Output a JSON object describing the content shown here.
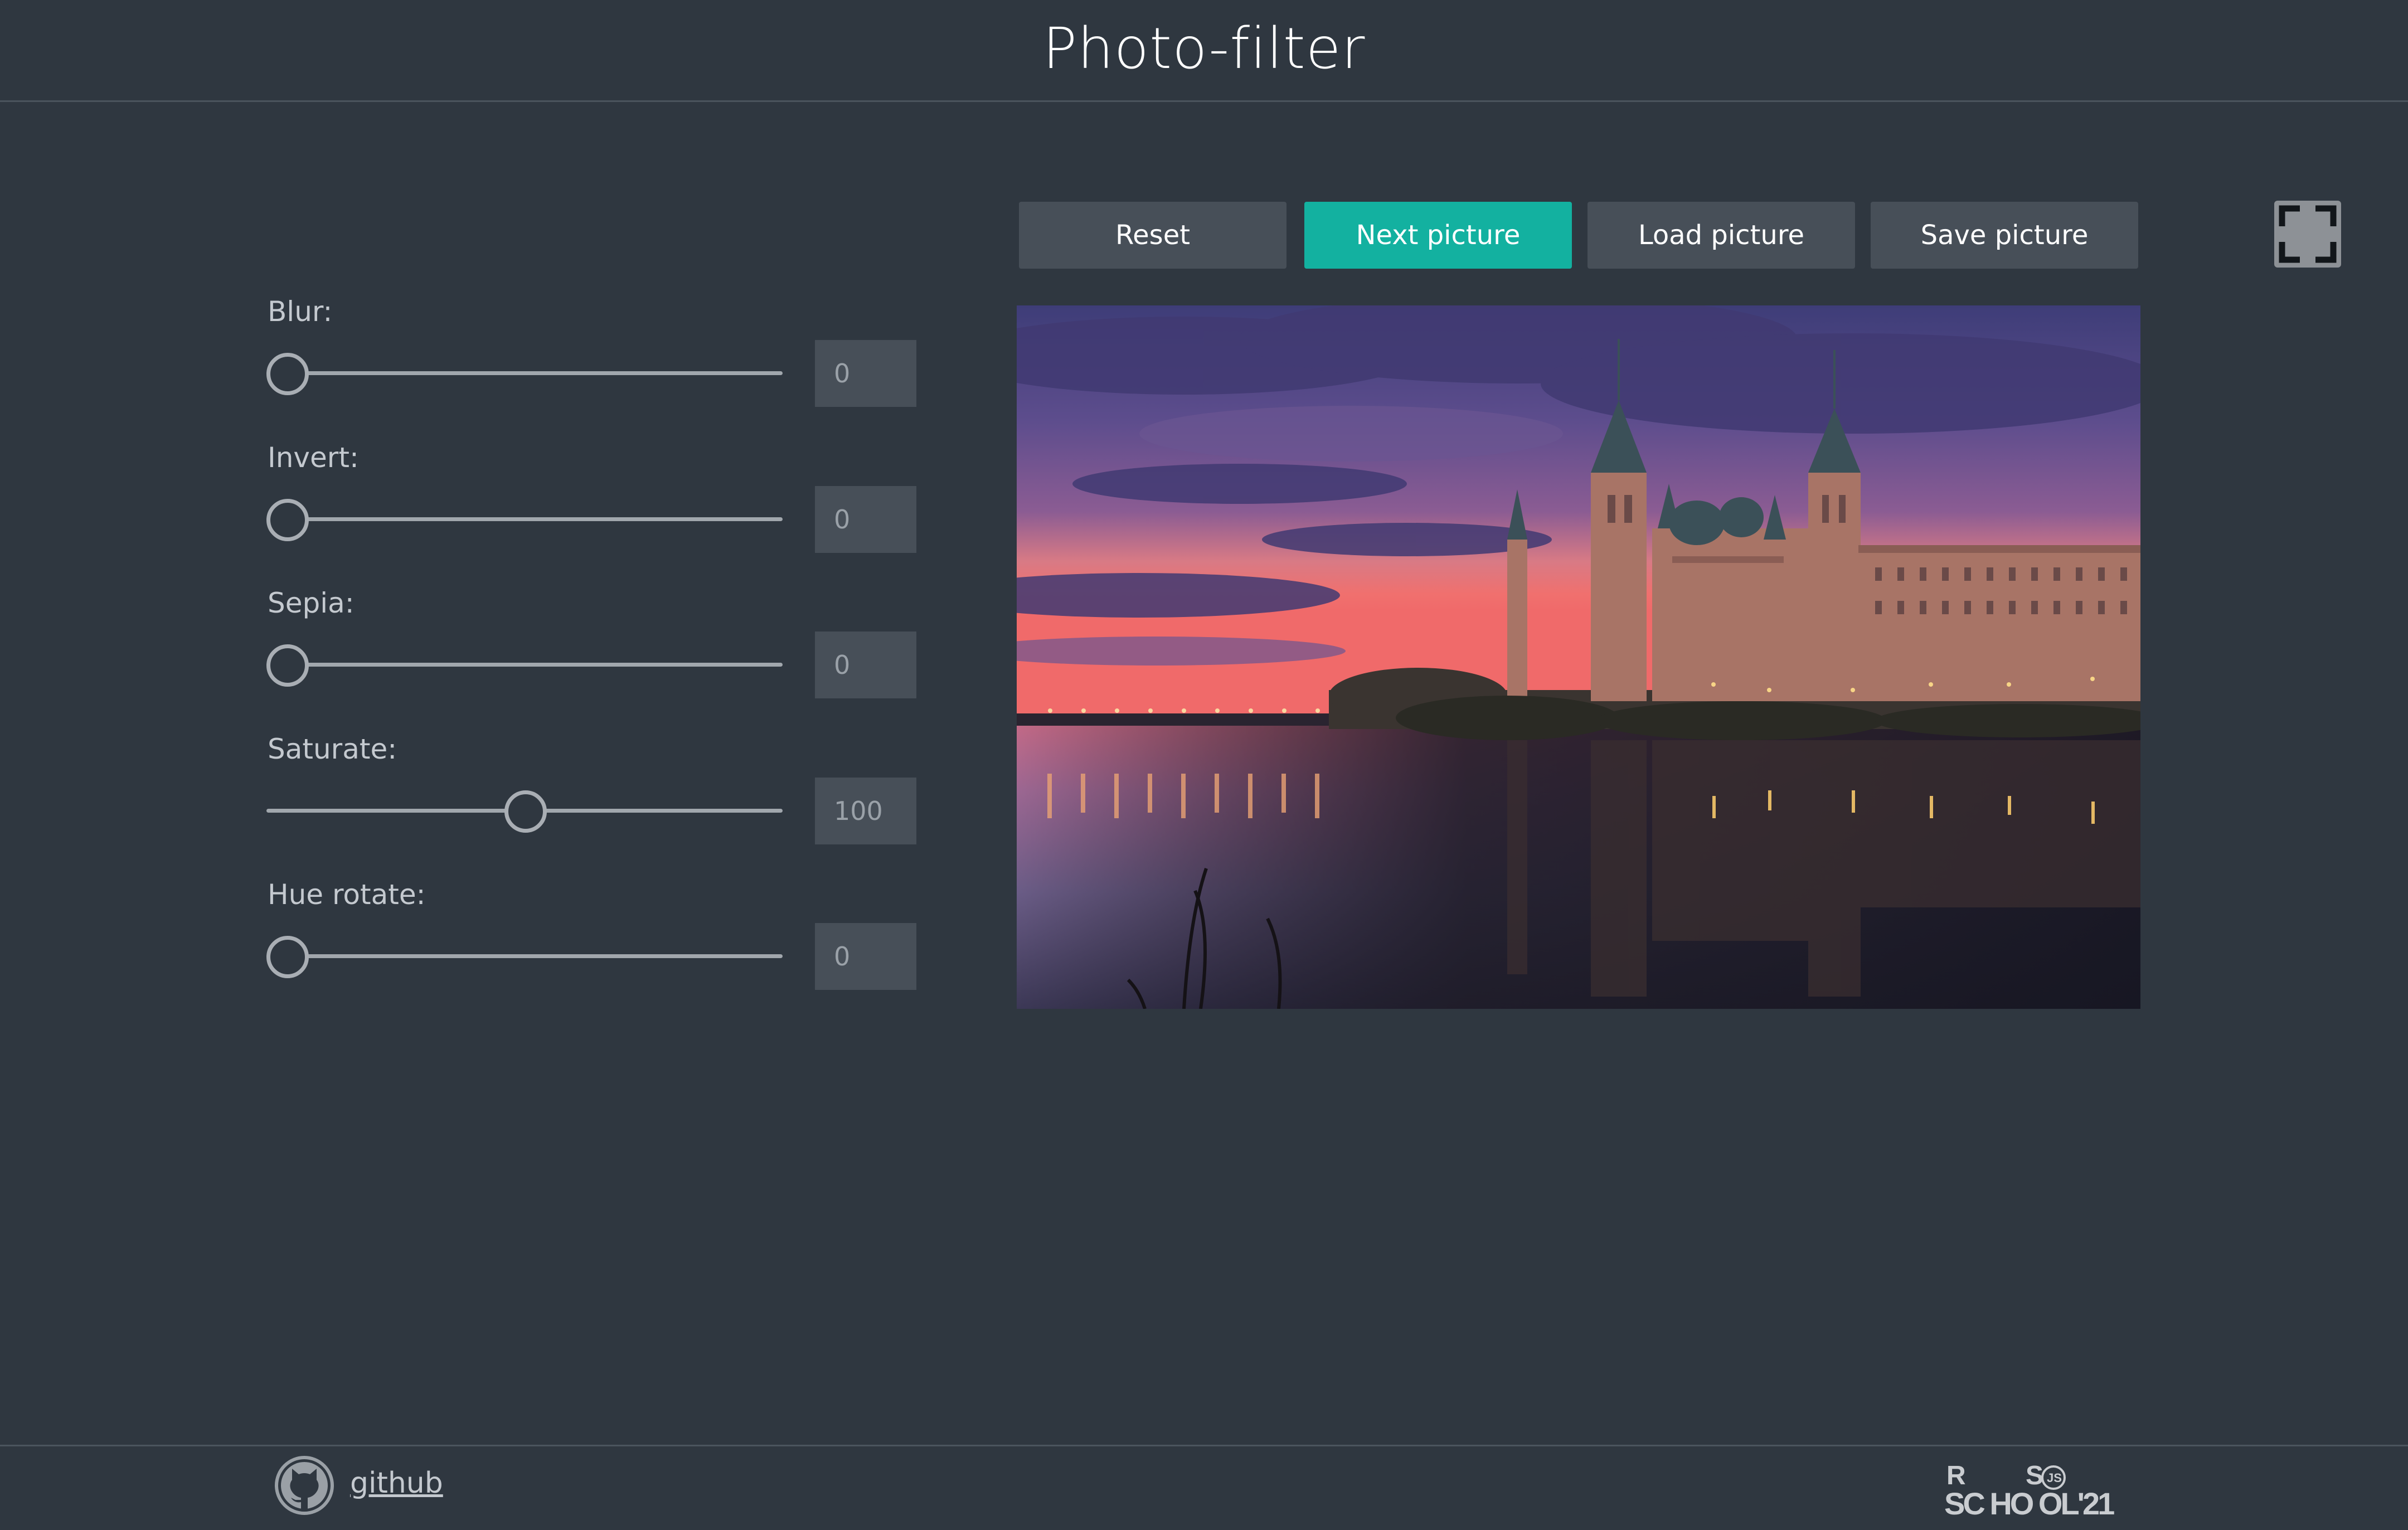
{
  "header": {
    "title": "Photo-filter"
  },
  "filters": [
    {
      "label": "Blur:",
      "value": "0",
      "level": 0
    },
    {
      "label": "Invert:",
      "value": "0",
      "level": 0
    },
    {
      "label": "Sepia:",
      "value": "0",
      "level": 0
    },
    {
      "label": "Saturate:",
      "value": "100",
      "level": 0.5
    },
    {
      "label": "Hue rotate:",
      "value": "0",
      "level": 0
    }
  ],
  "buttons": {
    "reset": "Reset",
    "next": "Next picture",
    "load": "Load picture",
    "save": "Save picture"
  },
  "colors": {
    "background": "#2f3740",
    "accent": "#13b1a0",
    "button": "#474f58"
  },
  "footer": {
    "github_label": "github",
    "logo": {
      "r": "R",
      "s": "S",
      "js": "JS",
      "bottom": "SC HO OL'21"
    }
  }
}
